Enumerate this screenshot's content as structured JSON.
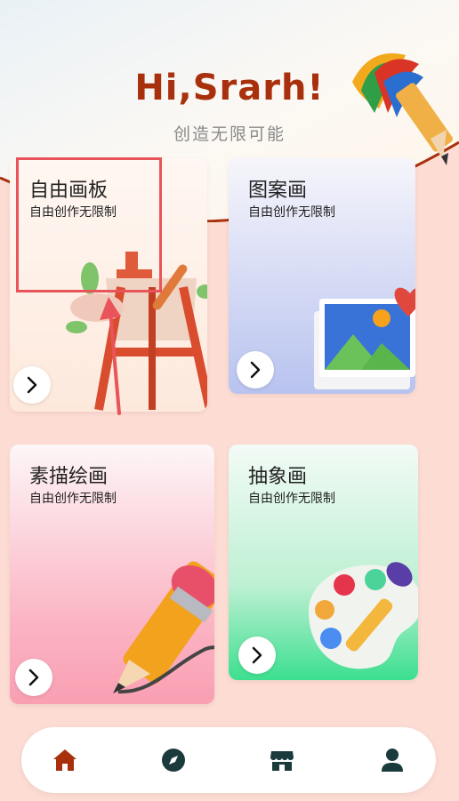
{
  "header": {
    "greeting": "Hi,Srarh!",
    "subtitle": "创造无限可能"
  },
  "cards": [
    {
      "title": "自由画板",
      "subtitle": "自由创作无限制",
      "illustration": "easel-icon"
    },
    {
      "title": "图案画",
      "subtitle": "自由创作无限制",
      "illustration": "picture-heart-icon"
    },
    {
      "title": "素描绘画",
      "subtitle": "自由创作无限制",
      "illustration": "pencil-icon"
    },
    {
      "title": "抽象画",
      "subtitle": "自由创作无限制",
      "illustration": "palette-icon"
    }
  ],
  "nav": {
    "items": [
      {
        "name": "home",
        "icon": "home-icon",
        "active": true
      },
      {
        "name": "discover",
        "icon": "compass-icon",
        "active": false
      },
      {
        "name": "store",
        "icon": "store-icon",
        "active": false
      },
      {
        "name": "profile",
        "icon": "user-icon",
        "active": false
      }
    ]
  },
  "colors": {
    "accent": "#a8300c",
    "background": "#fcdcd3",
    "highlight": "#e9545a"
  }
}
